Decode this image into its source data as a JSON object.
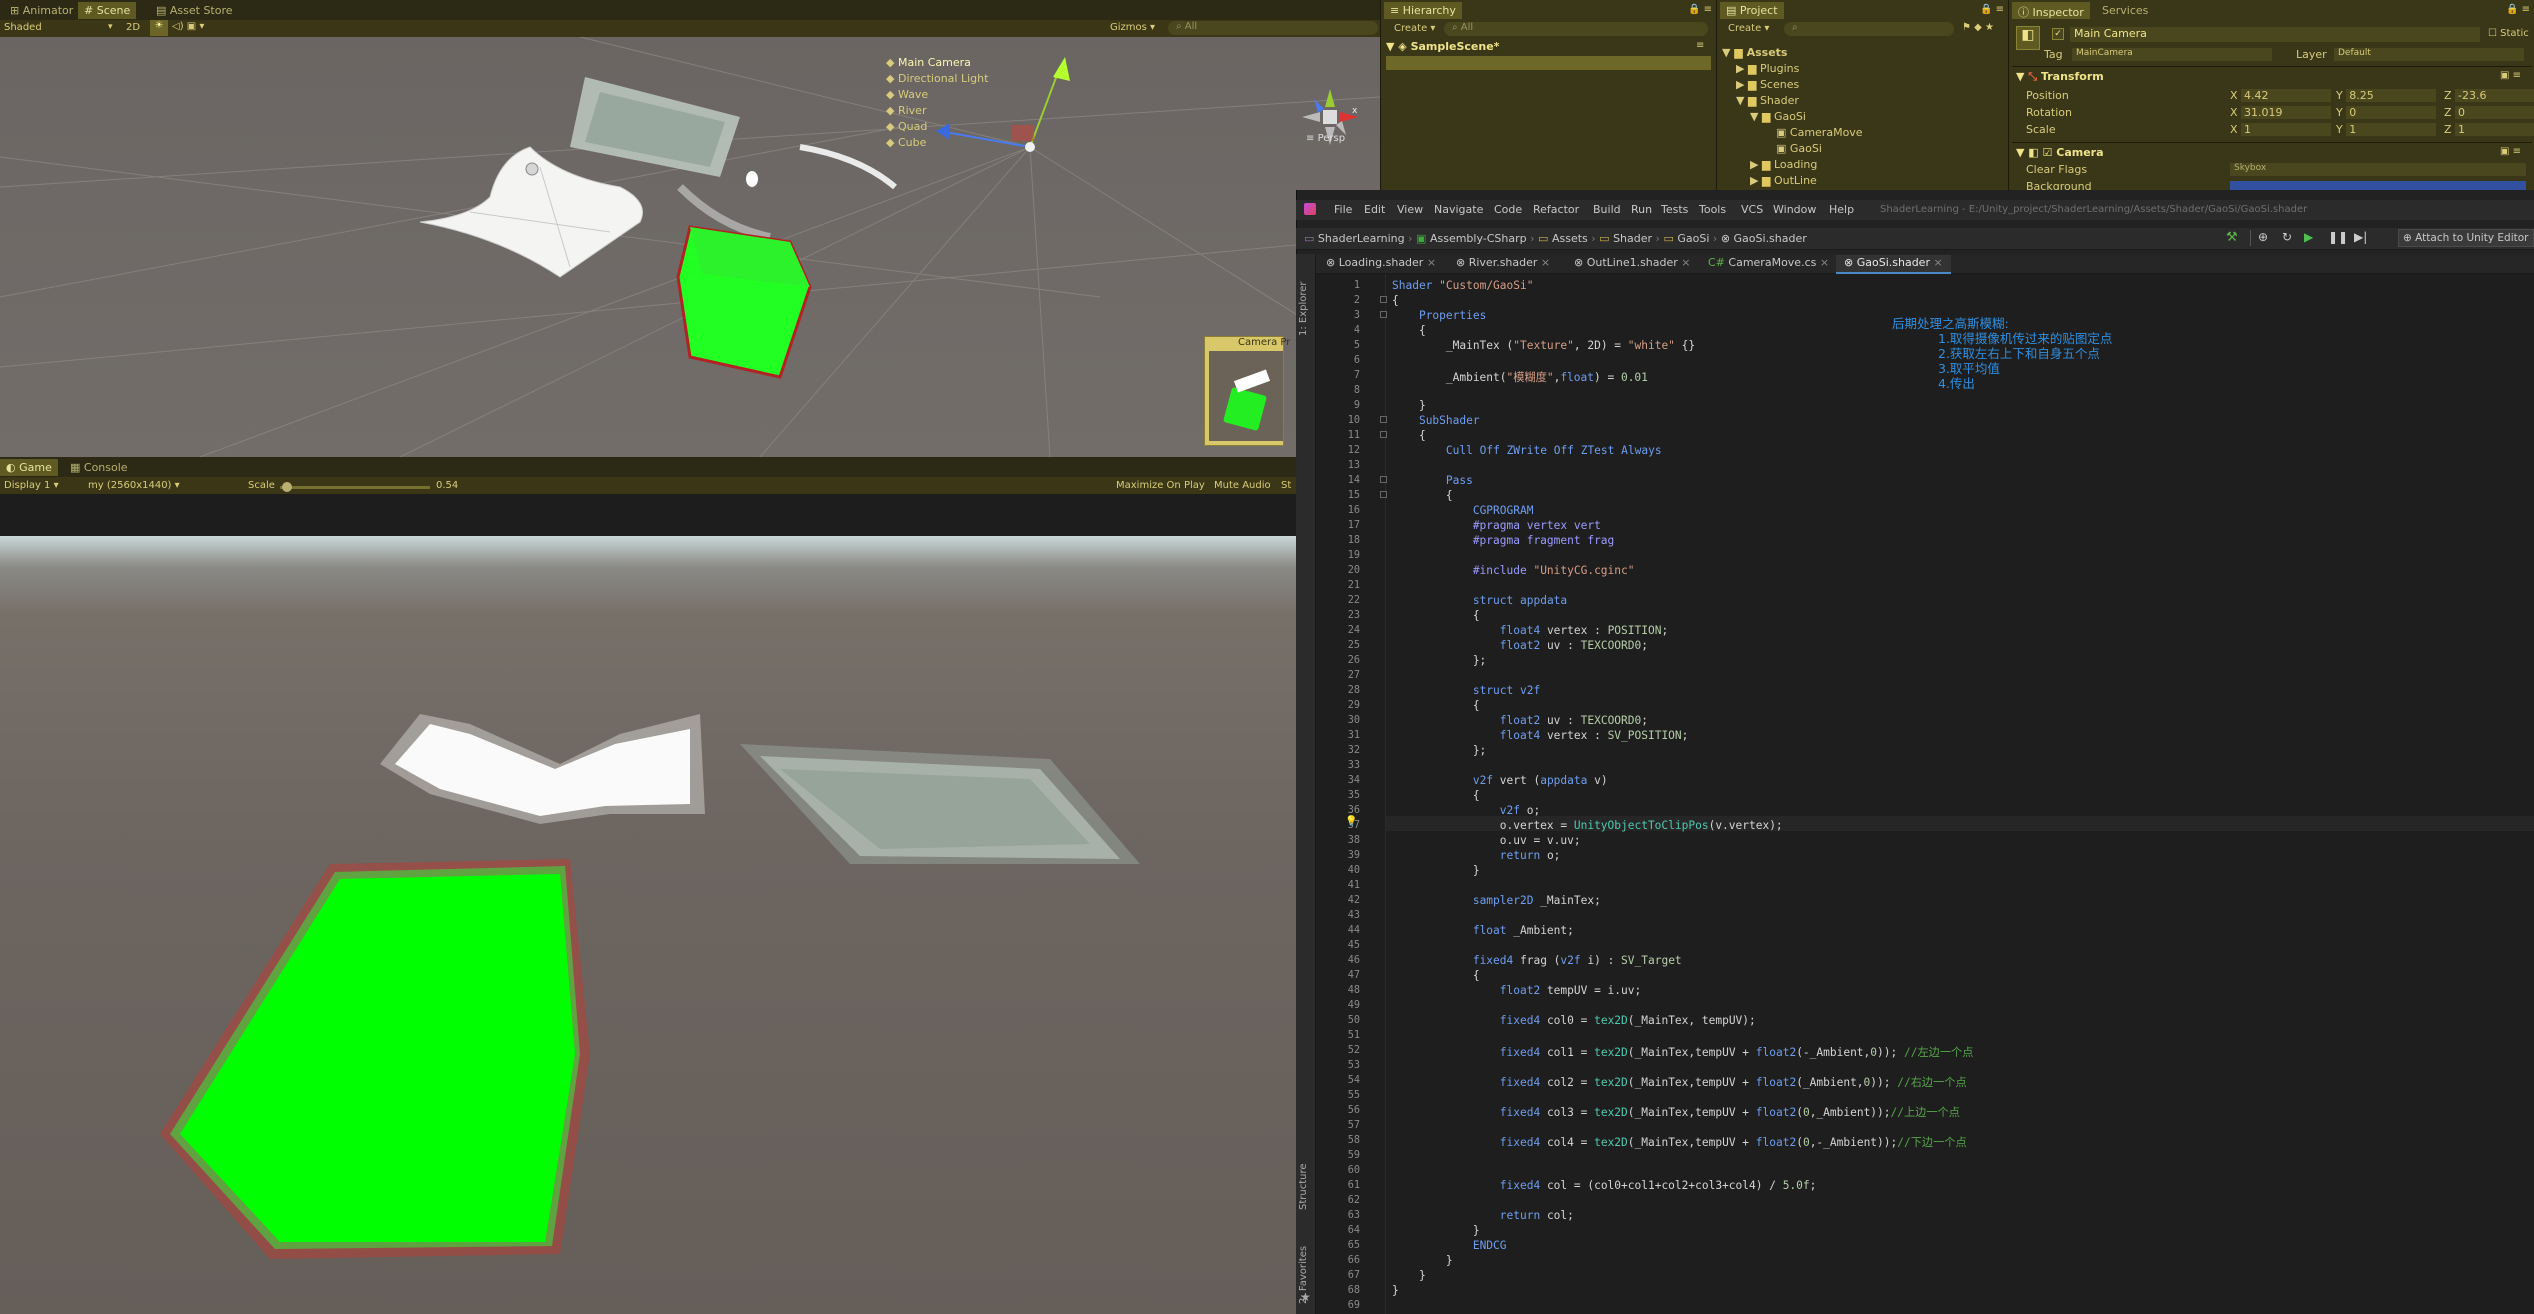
{
  "unity": {
    "tabs": [
      "Animator",
      "Scene",
      "Asset Store"
    ],
    "scene_toolbar": {
      "shading": "Shaded",
      "mode2d": "2D",
      "gizmos": "Gizmos",
      "search_placeholder": "All"
    },
    "persp_label": "Persp",
    "camera_preview_label": "Camera Pr",
    "game_tabs": [
      "Game",
      "Console"
    ],
    "game_toolbar": {
      "display": "Display 1",
      "resolution": "my (2560x1440)",
      "scale_label": "Scale",
      "scale_value": "0.54",
      "maximize": "Maximize On Play",
      "mute": "Mute Audio",
      "stats": "St"
    }
  },
  "hierarchy": {
    "tab": "Hierarchy",
    "create": "Create",
    "search_placeholder": "All",
    "scene": "SampleScene*",
    "items": [
      "Main Camera",
      "Directional Light",
      "Wave",
      "River",
      "Quad",
      "Cube"
    ]
  },
  "project": {
    "tab": "Project",
    "create": "Create",
    "tree": [
      "Assets",
      "Plugins",
      "Scenes",
      "Shader",
      "GaoSi",
      "CameraMove",
      "GaoSi",
      "Loading",
      "OutLine"
    ]
  },
  "inspector": {
    "tabs": [
      "Inspector",
      "Services"
    ],
    "object_name": "Main Camera",
    "static_label": "Static",
    "tag_label": "Tag",
    "tag_value": "MainCamera",
    "layer_label": "Layer",
    "layer_value": "Default",
    "transform_title": "Transform",
    "rows": [
      {
        "label": "Position",
        "x": "4.42",
        "y": "8.25",
        "z": "-23.6"
      },
      {
        "label": "Rotation",
        "x": "31.019",
        "y": "0",
        "z": "0"
      },
      {
        "label": "Scale",
        "x": "1",
        "y": "1",
        "z": "1"
      }
    ],
    "camera_title": "Camera",
    "clear_flags_label": "Clear Flags",
    "clear_flags_value": "Skybox",
    "background_label": "Background"
  },
  "rider": {
    "menu": [
      "File",
      "Edit",
      "View",
      "Navigate",
      "Code",
      "Refactor",
      "Build",
      "Run",
      "Tests",
      "Tools",
      "VCS",
      "Window",
      "Help"
    ],
    "title_path": "ShaderLearning - E:/Unity_project/ShaderLearning/Assets/Shader/GaoSi/GaoSi.shader",
    "breadcrumb": [
      "ShaderLearning",
      "Assembly-CSharp",
      "Assets",
      "Shader",
      "GaoSi",
      "GaoSi.shader"
    ],
    "attach_label": "Attach to Unity Editor",
    "file_tabs": [
      "Loading.shader",
      "River.shader",
      "OutLine1.shader",
      "CameraMove.cs",
      "GaoSi.shader"
    ],
    "side_labels": [
      "1: Explorer",
      "Structure",
      "2: Favorites"
    ],
    "notes": [
      "后期处理之高斯模糊:",
      "1.取得摄像机传过来的贴图定点",
      "2.获取左右上下和自身五个点",
      "3.取平均值",
      "4.传出"
    ]
  },
  "code_lines": [
    "Shader \"Custom/GaoSi\"",
    "{",
    "    Properties",
    "    {",
    "        _MainTex (\"Texture\", 2D) = \"white\" {}",
    "",
    "        _Ambient(\"模糊度\",float) = 0.01",
    "",
    "    }",
    "    SubShader",
    "    {",
    "        Cull Off ZWrite Off ZTest Always",
    "",
    "        Pass",
    "        {",
    "            CGPROGRAM",
    "            #pragma vertex vert",
    "            #pragma fragment frag",
    "",
    "            #include \"UnityCG.cginc\"",
    "",
    "            struct appdata",
    "            {",
    "                float4 vertex : POSITION;",
    "                float2 uv : TEXCOORD0;",
    "            };",
    "",
    "            struct v2f",
    "            {",
    "                float2 uv : TEXCOORD0;",
    "                float4 vertex : SV_POSITION;",
    "            };",
    "",
    "            v2f vert (appdata v)",
    "            {",
    "                v2f o;",
    "                o.vertex = UnityObjectToClipPos(v.vertex);",
    "                o.uv = v.uv;",
    "                return o;",
    "            }",
    "",
    "            sampler2D _MainTex;",
    "",
    "            float _Ambient;",
    "",
    "            fixed4 frag (v2f i) : SV_Target",
    "            {",
    "                float2 tempUV = i.uv;",
    "",
    "                fixed4 col0 = tex2D(_MainTex, tempUV);",
    "",
    "                fixed4 col1 = tex2D(_MainTex,tempUV + float2(-_Ambient,0)); //左边一个点",
    "",
    "                fixed4 col2 = tex2D(_MainTex,tempUV + float2(_Ambient,0)); //右边一个点",
    "",
    "                fixed4 col3 = tex2D(_MainTex,tempUV + float2(0,_Ambient));//上边一个点",
    "",
    "                fixed4 col4 = tex2D(_MainTex,tempUV + float2(0,-_Ambient));//下边一个点",
    "",
    "",
    "                fixed4 col = (col0+col1+col2+col3+col4) / 5.0f;",
    "",
    "                return col;",
    "            }",
    "            ENDCG",
    "        }",
    "    }",
    "}",
    ""
  ]
}
